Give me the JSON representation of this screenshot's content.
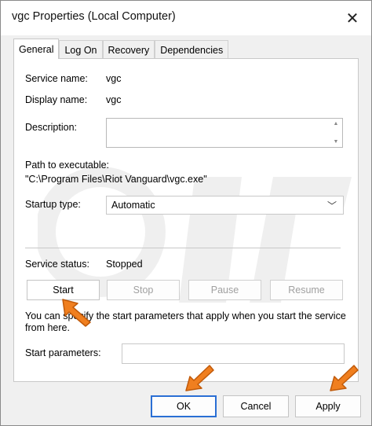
{
  "window": {
    "title": "vgc Properties (Local Computer)",
    "close_icon": "close-icon"
  },
  "tabs": [
    {
      "label": "General",
      "active": true
    },
    {
      "label": "Log On",
      "active": false
    },
    {
      "label": "Recovery",
      "active": false
    },
    {
      "label": "Dependencies",
      "active": false
    }
  ],
  "general": {
    "service_name_label": "Service name:",
    "service_name_value": "vgc",
    "display_name_label": "Display name:",
    "display_name_value": "vgc",
    "description_label": "Description:",
    "description_value": "",
    "path_label": "Path to executable:",
    "path_value": "\"C:\\Program Files\\Riot Vanguard\\vgc.exe\"",
    "startup_type_label": "Startup type:",
    "startup_type_value": "Automatic",
    "service_status_label": "Service status:",
    "service_status_value": "Stopped",
    "start_label": "Start",
    "stop_label": "Stop",
    "pause_label": "Pause",
    "resume_label": "Resume",
    "hint_line1": "You can specify the start parameters that apply when you start the service",
    "hint_line2": "from here.",
    "start_params_label": "Start parameters:",
    "start_params_value": ""
  },
  "footer": {
    "ok_label": "OK",
    "cancel_label": "Cancel",
    "apply_label": "Apply"
  },
  "colors": {
    "annotation_arrow": "#f07f1f",
    "focus_border": "#2a6fd4",
    "disabled_text": "#a0a0a0"
  }
}
